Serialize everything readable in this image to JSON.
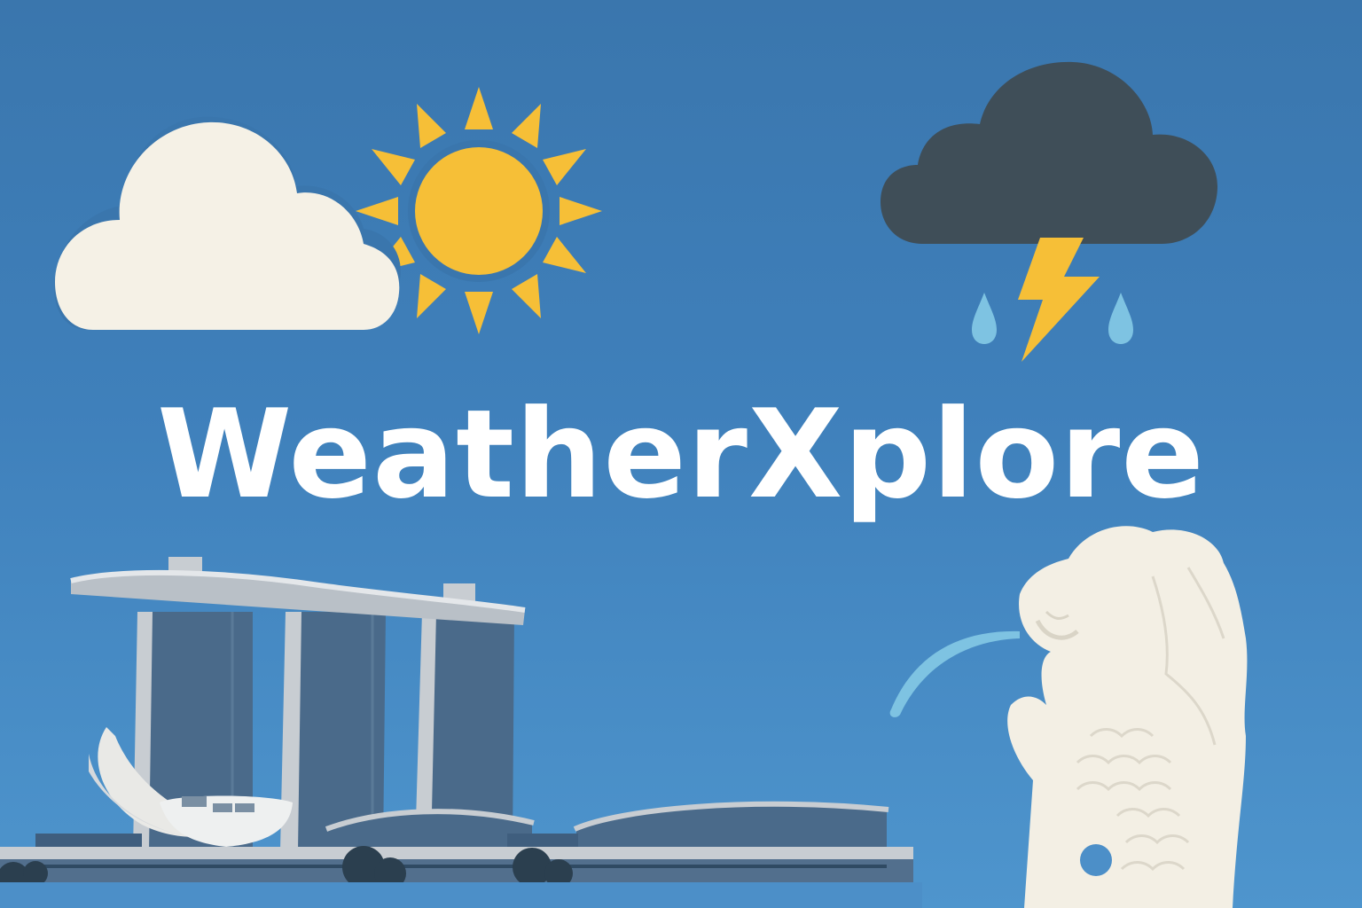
{
  "title": "WeatherXplore",
  "colors": {
    "sky_top": "#3a76ad",
    "sky_bottom": "#4e95cd",
    "cloud_light": "#f5f1e6",
    "sun": "#f6bf37",
    "storm_cloud": "#3f4e58",
    "lightning": "#f6bf37",
    "rain_drop": "#7ec3e2",
    "building_glass": "#4a6a8a",
    "building_frame": "#c8cdd2",
    "merlion": "#f3efe4"
  },
  "icons": [
    "partly-sunny-icon",
    "thunderstorm-icon",
    "marina-bay-sands-illustration",
    "merlion-illustration"
  ]
}
